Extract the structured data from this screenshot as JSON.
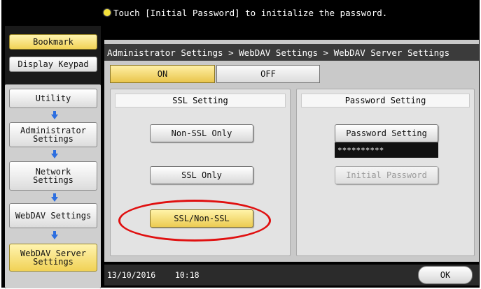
{
  "message": "Touch [Initial Password] to initialize the password.",
  "left_panel": {
    "bookmark": "Bookmark",
    "display_keypad": "Display Keypad",
    "utility": "Utility",
    "administrator_settings": "Administrator\nSettings",
    "network_settings": "Network\nSettings",
    "webdav_settings": "WebDAV Settings",
    "webdav_server_settings": "WebDAV Server\nSettings"
  },
  "breadcrumb": "Administrator Settings > WebDAV Settings > WebDAV Server Settings",
  "toggle": {
    "on": "ON",
    "off": "OFF",
    "selected": "ON"
  },
  "ssl_setting": {
    "title": "SSL Setting",
    "options": [
      "Non-SSL Only",
      "SSL Only",
      "SSL/Non-SSL"
    ],
    "selected": "SSL/Non-SSL"
  },
  "password_setting": {
    "title": "Password Setting",
    "button": "Password Setting",
    "masked_value": "**********",
    "initial_password": "Initial Password"
  },
  "footer": {
    "date": "13/10/2016",
    "time": "10:18",
    "ok": "OK"
  },
  "colors": {
    "selected_yellow": "#f1d256",
    "highlight_red": "#e01010",
    "arrow_blue": "#2d6fe0"
  }
}
